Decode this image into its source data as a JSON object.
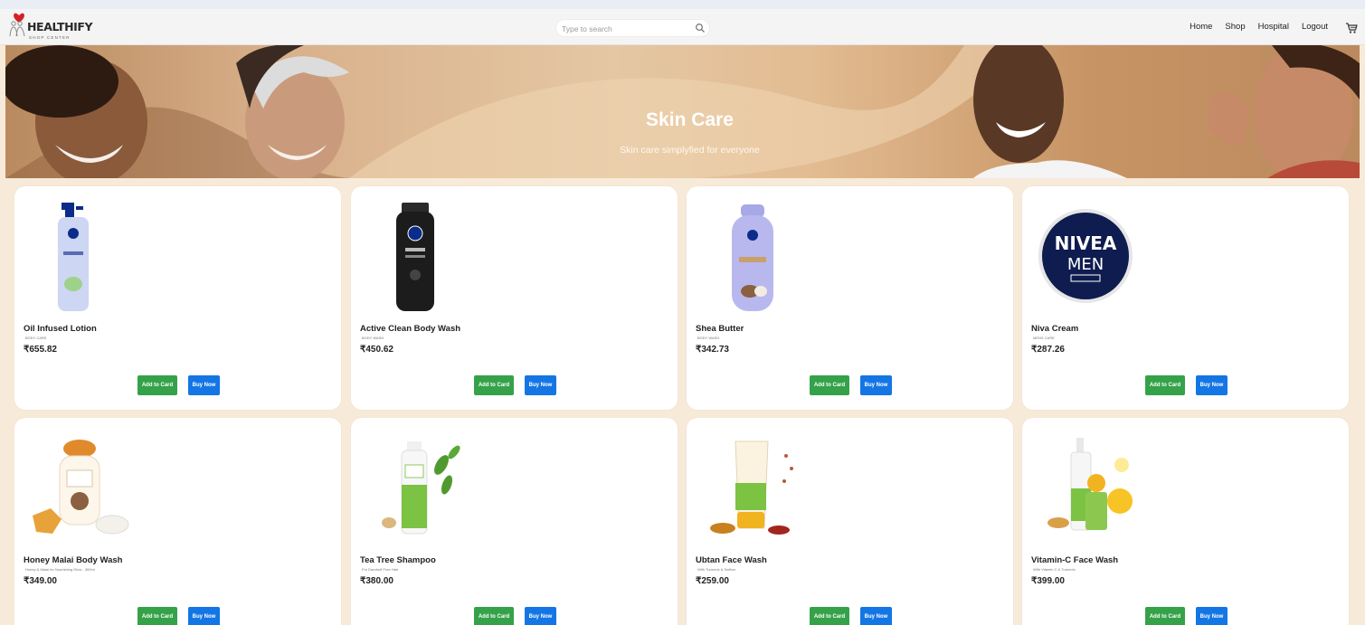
{
  "navbar": {
    "logo_text": "HEALTHIFY",
    "logo_sub": "SHOP CENTER",
    "search_placeholder": "Type to search",
    "links": [
      "Home",
      "Shop",
      "Hospital",
      "Logout"
    ],
    "cart_icon": "cart-icon"
  },
  "hero": {
    "title": "Skin Care",
    "subtitle": "Skin care simplyfied for everyone"
  },
  "buttons": {
    "add": "Add to Card",
    "buy": "Buy Now"
  },
  "colors": {
    "add_button": "#35a24a",
    "buy_button": "#1476e4",
    "page_bg": "#f8ead9",
    "card_bg": "#ffffff"
  },
  "products": [
    {
      "name": "Oil Infused Lotion",
      "category": "BODY CARE",
      "price": "₹655.82"
    },
    {
      "name": "Active Clean Body Wash",
      "category": "BODY WASH",
      "price": "₹450.62"
    },
    {
      "name": "Shea Butter",
      "category": "BODY WASH",
      "price": "₹342.73"
    },
    {
      "name": "Niva Cream",
      "category": "MENS CARE",
      "price": "₹287.26"
    },
    {
      "name": "Honey Malai Body Wash",
      "category": "Honey & Malai for Nourishing Glow - 300ml",
      "price": "₹349.00"
    },
    {
      "name": "Tea Tree Shampoo",
      "category": "For Dandruff Free Hair",
      "price": "₹380.00"
    },
    {
      "name": "Ubtan Face Wash",
      "category": "With Turmeric & Saffron",
      "price": "₹259.00"
    },
    {
      "name": "Vitamin-C Face Wash",
      "category": "With Vitamin C & Turmeric",
      "price": "₹399.00"
    }
  ]
}
